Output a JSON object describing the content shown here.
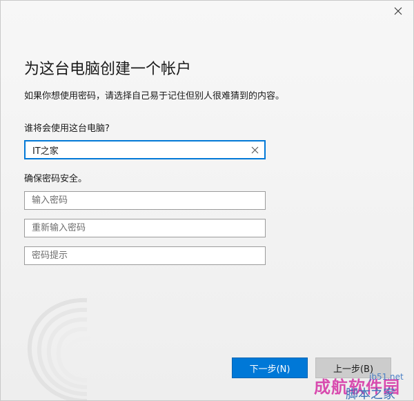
{
  "dialog": {
    "title": "为这台电脑创建一个帐户",
    "description": "如果你想使用密码，请选择自己易于记住但别人很难猜到的内容。",
    "who_label": "谁将会使用这台电脑?",
    "username_value": "IT之家",
    "secure_label": "确保密码安全。",
    "password_placeholder": "输入密码",
    "reenter_placeholder": "重新输入密码",
    "hint_placeholder": "密码提示",
    "next_label": "下一步(N)",
    "back_label": "上一步(B)",
    "accent_color": "#0078d7"
  },
  "icons": {
    "close": "close-icon",
    "clear": "clear-icon"
  },
  "watermark": {
    "brand": "成航软件园",
    "url": "jb51.net",
    "subtitle": "脚本之家"
  }
}
